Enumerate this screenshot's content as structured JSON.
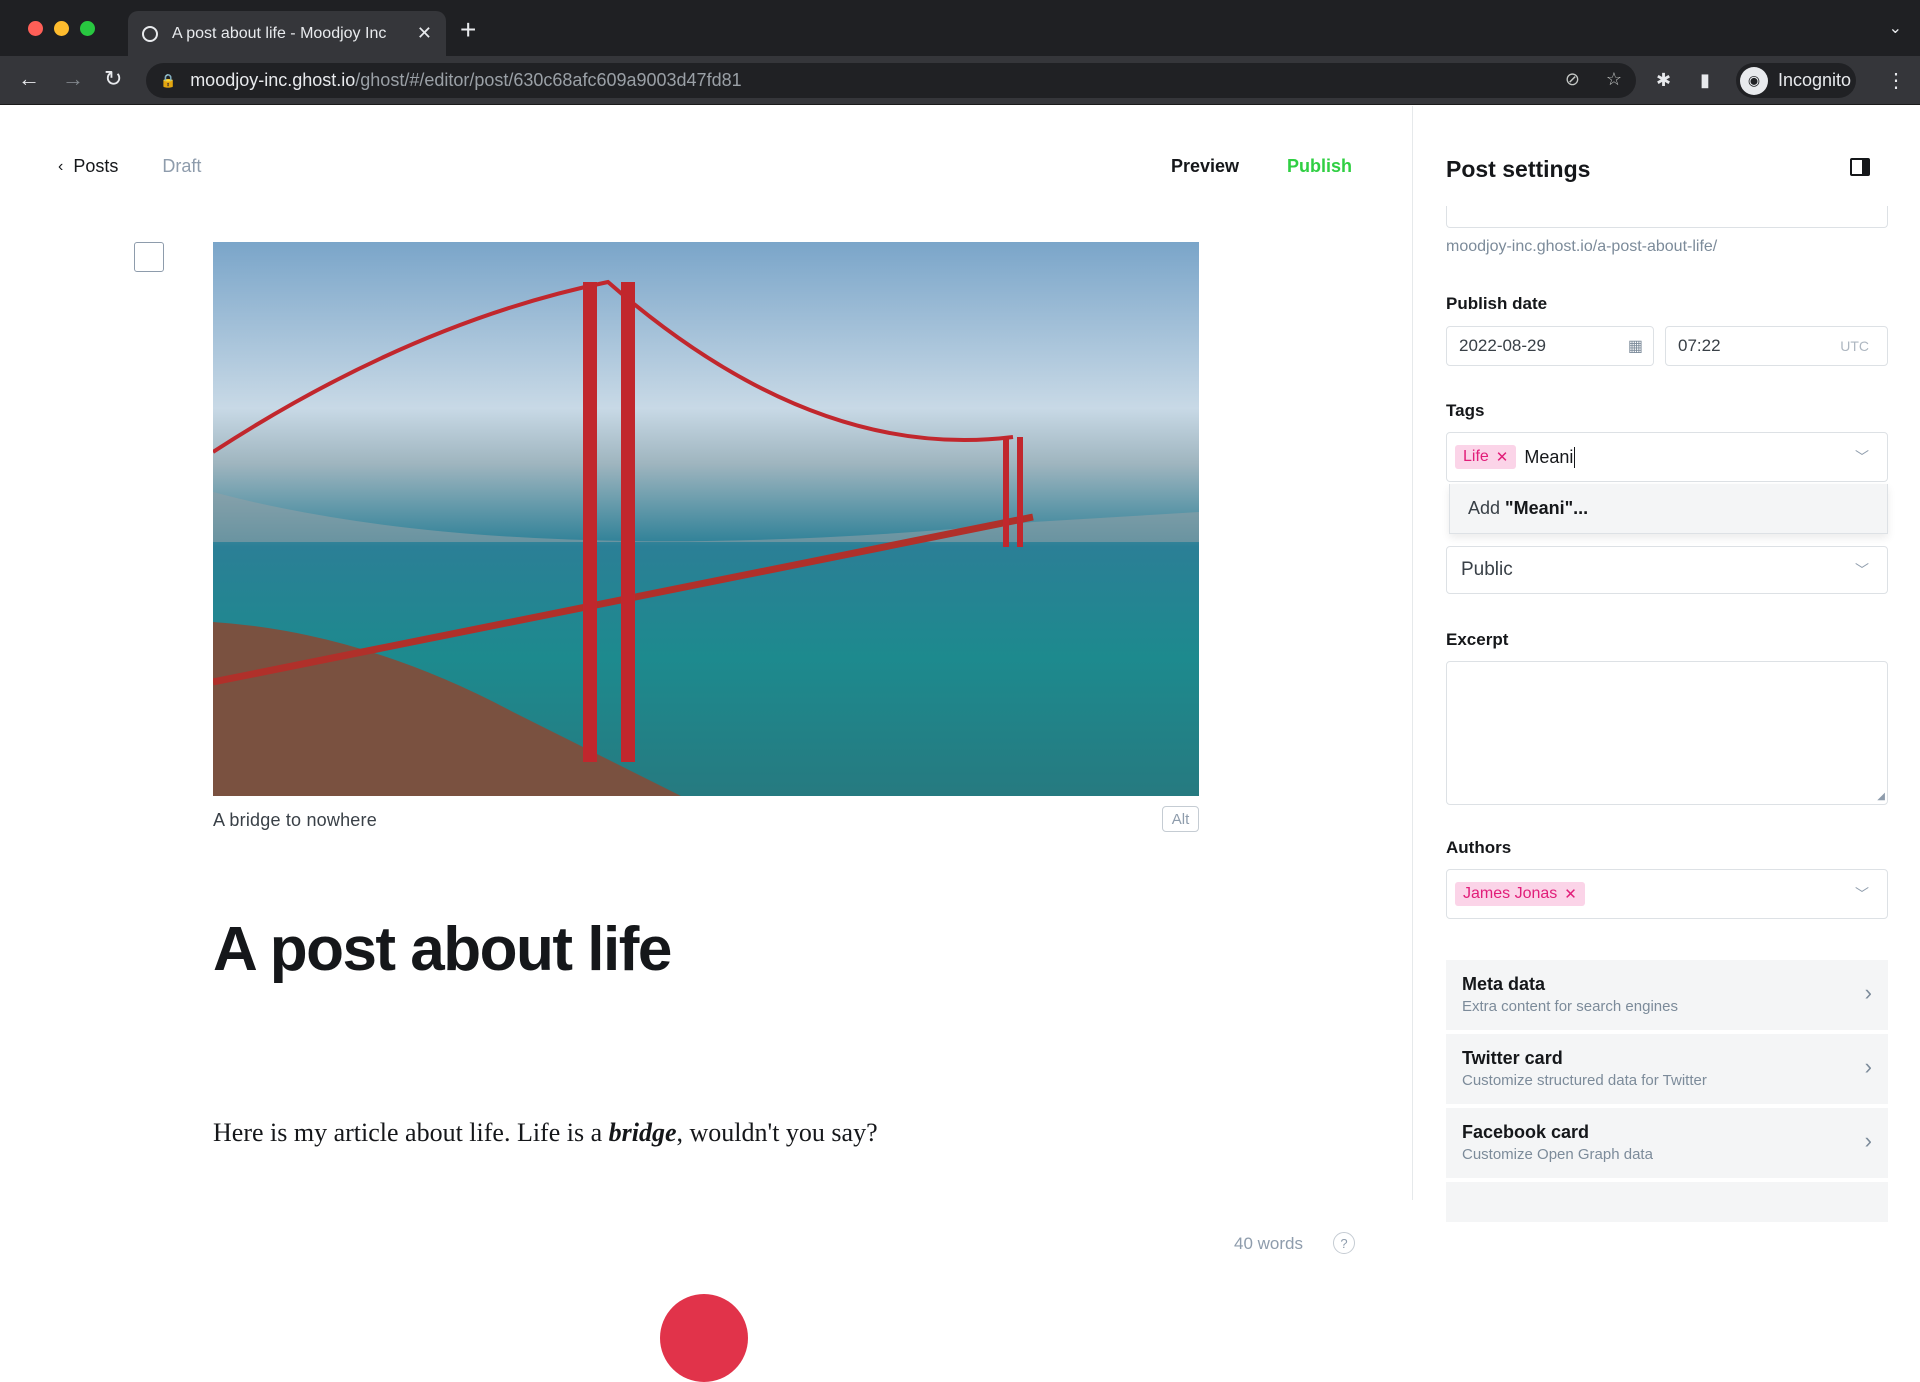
{
  "browser": {
    "tab_title": "A post about life - Moodjoy Inc",
    "url_host": "moodjoy-inc.ghost.io",
    "url_path": "/ghost/#/editor/post/630c68afc609a9003d47fd81",
    "profile_label": "Incognito",
    "icons": {
      "back": "←",
      "forward": "→",
      "reload": "↻",
      "lock": "🔒",
      "eye_off": "⊘",
      "star": "☆",
      "puzzle": "✱",
      "sidebar": "▮",
      "kebab": "⋮",
      "new_tab": "+",
      "close": "✕",
      "tabs_chevron": "⌄"
    }
  },
  "editor": {
    "back_label": "Posts",
    "status": "Draft",
    "preview_label": "Preview",
    "publish_label": "Publish",
    "image_caption": "A bridge to nowhere",
    "alt_label": "Alt",
    "title": "A post about life",
    "body_before": "Here is my article about life. Life is a ",
    "body_emphasis": "bridge",
    "body_after": ", wouldn't you say?",
    "word_count": "40 words",
    "help_icon": "?"
  },
  "settings": {
    "title": "Post settings",
    "url_hint": "moodjoy-inc.ghost.io/a-post-about-life/",
    "publish_date_label": "Publish date",
    "date_value": "2022-08-29",
    "time_value": "07:22",
    "timezone": "UTC",
    "tags_label": "Tags",
    "tags": [
      {
        "name": "Life"
      }
    ],
    "tag_input_value": "Meani",
    "dropdown_prefix": "Add ",
    "dropdown_term": "\"Meani\"...",
    "visibility_value": "Public",
    "excerpt_label": "Excerpt",
    "excerpt_value": "",
    "authors_label": "Authors",
    "authors": [
      {
        "name": "James Jonas"
      }
    ],
    "nav_cards": [
      {
        "title": "Meta data",
        "subtitle": "Extra content for search engines"
      },
      {
        "title": "Twitter card",
        "subtitle": "Customize structured data for Twitter"
      },
      {
        "title": "Facebook card",
        "subtitle": "Customize Open Graph data"
      }
    ]
  },
  "colors": {
    "publish_green": "#30cf43",
    "tag_pink_bg": "#fbd4e8",
    "tag_pink_text": "#e11d79"
  }
}
